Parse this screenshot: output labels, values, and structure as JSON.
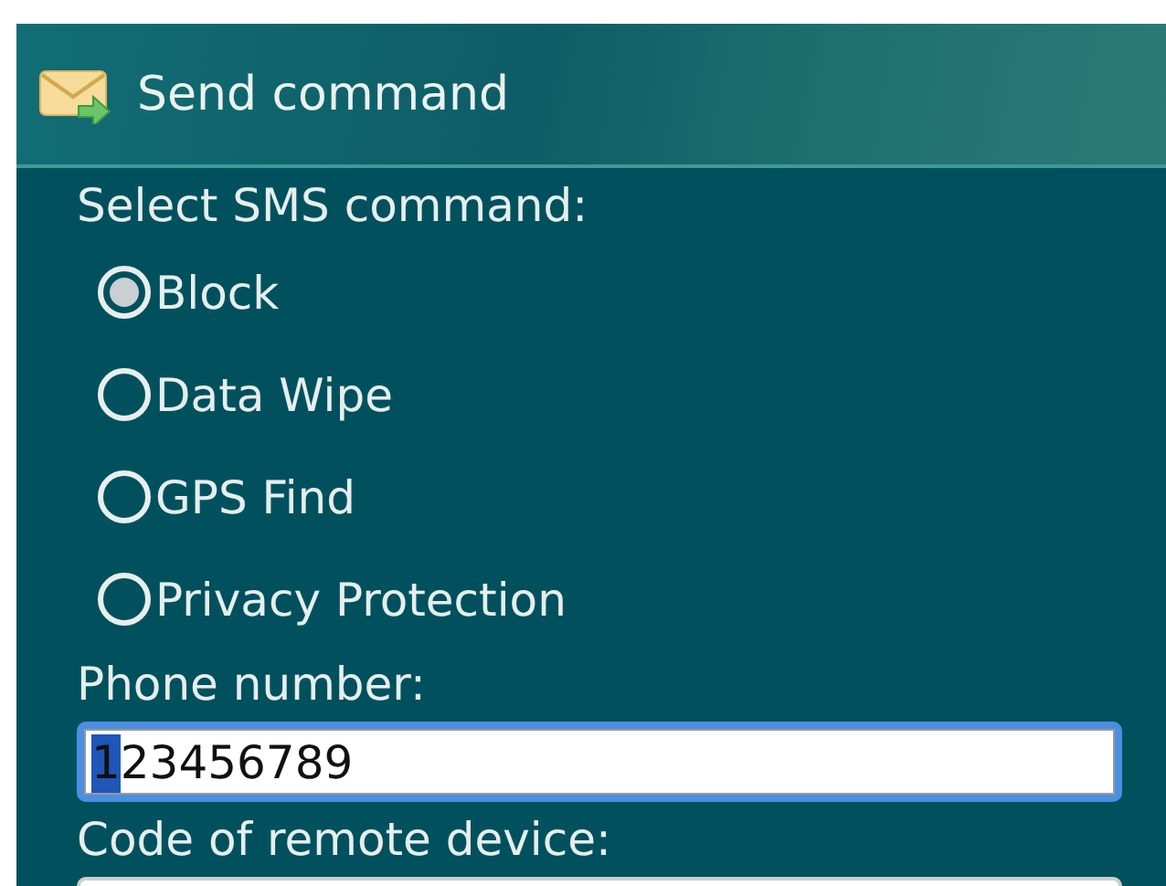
{
  "window": {
    "title": "Send command"
  },
  "command_label": "Select SMS command:",
  "commands": [
    {
      "label": "Block",
      "selected": true
    },
    {
      "label": "Data Wipe",
      "selected": false
    },
    {
      "label": "GPS Find",
      "selected": false
    },
    {
      "label": "Privacy Protection",
      "selected": false
    }
  ],
  "fields": [
    {
      "label": "Phone number:",
      "value": "123456789",
      "focused": true
    },
    {
      "label": "Code of remote device:",
      "focused": false
    }
  ]
}
